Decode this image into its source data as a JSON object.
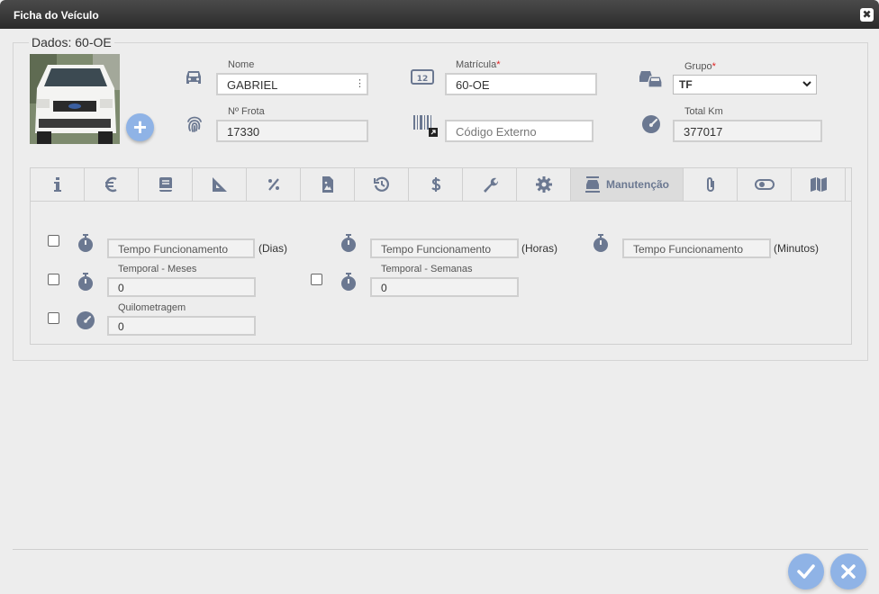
{
  "window": {
    "title": "Ficha do Veículo",
    "close_glyph": "✖"
  },
  "section": {
    "legend": "Dados: 60-OE"
  },
  "fields": {
    "nome": {
      "label": "Nome",
      "value": "GABRIEL"
    },
    "matricula": {
      "label": "Matrícula",
      "required": "*",
      "value": "60-OE"
    },
    "grupo": {
      "label": "Grupo",
      "required": "*",
      "value": "TF"
    },
    "frota": {
      "label": "Nº Frota",
      "value": "17330"
    },
    "codigo_externo": {
      "placeholder": "Código Externo"
    },
    "total_km": {
      "label": "Total Km",
      "value": "377017"
    }
  },
  "tabs": [
    {
      "icon": "info-icon"
    },
    {
      "icon": "euro-icon"
    },
    {
      "icon": "book-icon"
    },
    {
      "icon": "set-square-icon"
    },
    {
      "icon": "percent-icon"
    },
    {
      "icon": "image-file-icon"
    },
    {
      "icon": "history-icon"
    },
    {
      "icon": "dollar-icon"
    },
    {
      "icon": "wrench-icon"
    },
    {
      "icon": "gear-icon"
    },
    {
      "icon": "car-lift-icon",
      "label": "Manutenção",
      "active": true
    },
    {
      "icon": "paperclip-icon"
    },
    {
      "icon": "toggle-icon"
    },
    {
      "icon": "map-icon"
    }
  ],
  "maintenance": {
    "tempo_dias": {
      "placeholder": "Tempo Funcionamento",
      "unit": "(Dias)"
    },
    "tempo_horas": {
      "placeholder": "Tempo Funcionamento",
      "unit": "(Horas)"
    },
    "tempo_minutos": {
      "placeholder": "Tempo Funcionamento",
      "unit": "(Minutos)"
    },
    "temporal_meses": {
      "label": "Temporal - Meses",
      "value": "0"
    },
    "temporal_semanas": {
      "label": "Temporal - Semanas",
      "value": "0"
    },
    "quilometragem": {
      "label": "Quilometragem",
      "value": "0"
    }
  },
  "colors": {
    "accent": "#8fb3e6",
    "icon": "#6b7891",
    "required": "#e02020"
  }
}
